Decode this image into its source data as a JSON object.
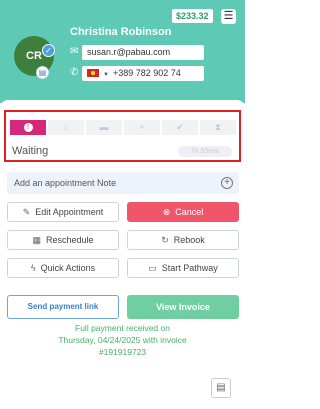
{
  "header": {
    "balance": "$233.32",
    "menu_icon": "menu-icon",
    "client_name": "Christina Robinson",
    "avatar_initials": "CR",
    "email": "susan.r@pabau.com",
    "phone": "+389 782 902 74",
    "accent_color": "#5ec9b4"
  },
  "pipeline": {
    "stages": [
      {
        "icon": "alert-icon",
        "active": true
      },
      {
        "icon": "home-icon",
        "active": false
      },
      {
        "icon": "bed-icon",
        "active": false
      },
      {
        "icon": "plus-icon",
        "active": false
      },
      {
        "icon": "check-icon",
        "active": false
      },
      {
        "icon": "hourglass-icon",
        "active": false
      }
    ],
    "status": "Waiting",
    "duration": "7h 55min",
    "active_color": "#d6287a"
  },
  "note": {
    "placeholder": "Add an appointment Note"
  },
  "actions": {
    "edit": "Edit Appointment",
    "cancel": "Cancel",
    "reschedule": "Reschedule",
    "rebook": "Rebook",
    "quick_actions": "Quick Actions",
    "start_pathway": "Start Pathway"
  },
  "payment": {
    "send_link": "Send payment link",
    "view_invoice": "View Invoice",
    "status_line1": "Full payment received on",
    "status_line2": "Thursday, 04/24/2025 with invoice",
    "status_line3": "#191919723"
  }
}
